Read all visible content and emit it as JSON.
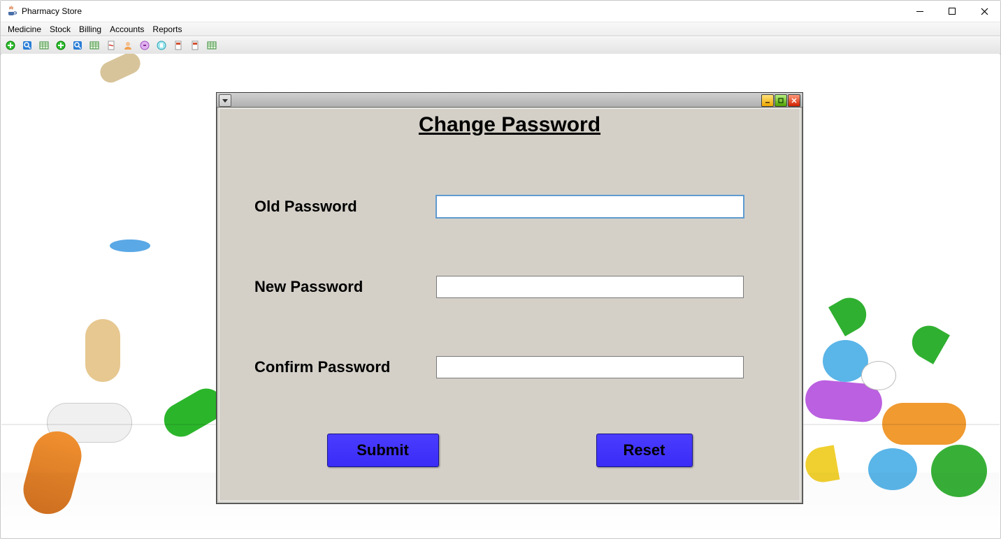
{
  "window": {
    "title": "Pharmacy Store"
  },
  "menu": {
    "items": [
      "Medicine",
      "Stock",
      "Billing",
      "Accounts",
      "Reports"
    ]
  },
  "toolbar": {
    "icons": [
      "plus-green",
      "search-blue",
      "table",
      "plus-green",
      "search-blue",
      "table",
      "doc-red",
      "circle-orange",
      "circle-purple",
      "circle-cyan",
      "doc-red-b",
      "doc-red-c",
      "table"
    ]
  },
  "dialog": {
    "title": "Change Password",
    "old_password_label": "Old Password",
    "new_password_label": "New Password",
    "confirm_password_label": "Confirm Password",
    "old_password_value": "",
    "new_password_value": "",
    "confirm_password_value": "",
    "submit_label": "Submit",
    "reset_label": "Reset"
  }
}
